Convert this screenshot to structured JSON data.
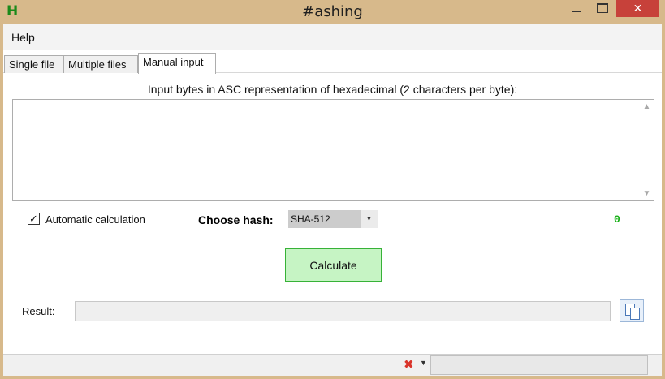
{
  "window": {
    "title": "#ashing",
    "app_icon_letter": "H"
  },
  "menu": {
    "help": "Help"
  },
  "tabs": [
    {
      "label": "Single file",
      "active": false
    },
    {
      "label": "Multiple files",
      "active": false
    },
    {
      "label": "Manual input",
      "active": true
    }
  ],
  "manual_input": {
    "prompt": "Input bytes in ASC representation of hexadecimal (2 characters per byte):",
    "input_value": "",
    "auto_calculation": {
      "label": "Automatic calculation",
      "checked": true,
      "check_glyph": "✓"
    },
    "hash": {
      "label": "Choose hash:",
      "selected": "SHA-512"
    },
    "byte_count": "0",
    "calculate_label": "Calculate",
    "result_label": "Result:",
    "result_value": ""
  },
  "status": {
    "icon": "error-x-icon",
    "text": ""
  },
  "colors": {
    "accent_green": "#18b018",
    "button_bg": "#c6f4c4",
    "close_red": "#c7413a",
    "window_frame": "#d7b98b"
  }
}
